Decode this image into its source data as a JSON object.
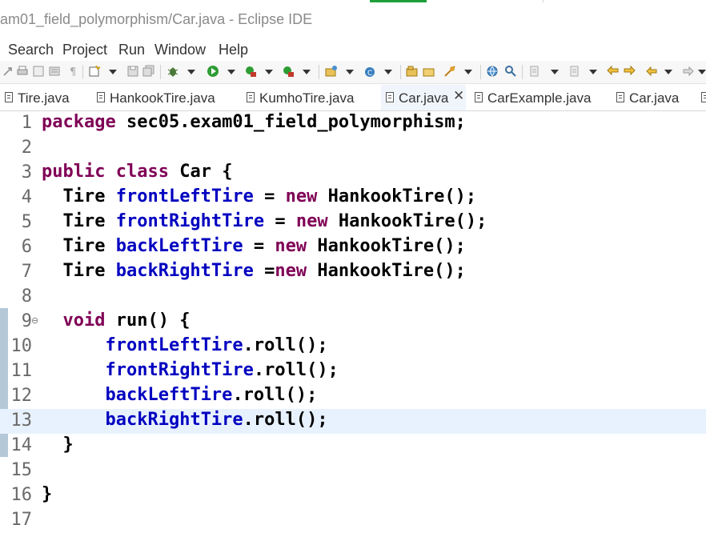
{
  "window": {
    "title": "am01_field_polymorphism/Car.java - Eclipse IDE"
  },
  "menu": [
    "Search",
    "Project",
    "Run",
    "Window",
    "Help"
  ],
  "toolbar": {
    "icons": [
      "arrow-icon",
      "print-icon",
      "format-icon",
      "pilcrow-icon",
      "new-icon",
      "save-icon",
      "save-all-icon",
      "debug-icon",
      "run-icon",
      "coverage-icon",
      "external-tools-icon",
      "new-java-project-icon",
      "new-class-icon",
      "open-type-icon",
      "search-icon",
      "globe-icon",
      "open-task-icon",
      "annotation-icon",
      "next-annotation-icon",
      "back-icon",
      "forward-icon"
    ]
  },
  "tabs": [
    {
      "label": "Tire.java",
      "active": false
    },
    {
      "label": "HankookTire.java",
      "active": false
    },
    {
      "label": "KumhoTire.java",
      "active": false
    },
    {
      "label": "Car.java",
      "active": true,
      "close": "✕"
    },
    {
      "label": "CarExample.java",
      "active": false
    },
    {
      "label": "Car.java",
      "active": false
    }
  ],
  "editor": {
    "current_line": 13,
    "lines": [
      {
        "n": "1",
        "tokens": [
          {
            "t": "package",
            "c": "kw"
          },
          {
            "t": " sec05.exam01_field_polymorphism;",
            "c": ""
          }
        ]
      },
      {
        "n": "2",
        "tokens": []
      },
      {
        "n": "3",
        "tokens": [
          {
            "t": "public",
            "c": "kw"
          },
          {
            "t": " ",
            "c": ""
          },
          {
            "t": "class",
            "c": "kw"
          },
          {
            "t": " Car {",
            "c": ""
          }
        ]
      },
      {
        "n": "4",
        "tokens": [
          {
            "t": "  Tire ",
            "c": ""
          },
          {
            "t": "frontLeftTire",
            "c": "fld"
          },
          {
            "t": " = ",
            "c": ""
          },
          {
            "t": "new",
            "c": "kw"
          },
          {
            "t": " HankookTire();",
            "c": ""
          }
        ]
      },
      {
        "n": "5",
        "tokens": [
          {
            "t": "  Tire ",
            "c": ""
          },
          {
            "t": "frontRightTire",
            "c": "fld"
          },
          {
            "t": " = ",
            "c": ""
          },
          {
            "t": "new",
            "c": "kw"
          },
          {
            "t": " HankookTire();",
            "c": ""
          }
        ]
      },
      {
        "n": "6",
        "tokens": [
          {
            "t": "  Tire ",
            "c": ""
          },
          {
            "t": "backLeftTire",
            "c": "fld"
          },
          {
            "t": " = ",
            "c": ""
          },
          {
            "t": "new",
            "c": "kw"
          },
          {
            "t": " HankookTire();",
            "c": ""
          }
        ]
      },
      {
        "n": "7",
        "tokens": [
          {
            "t": "  Tire ",
            "c": ""
          },
          {
            "t": "backRightTire",
            "c": "fld"
          },
          {
            "t": " =",
            "c": ""
          },
          {
            "t": "new",
            "c": "kw"
          },
          {
            "t": " HankookTire();",
            "c": ""
          }
        ]
      },
      {
        "n": "8",
        "tokens": []
      },
      {
        "n": "9",
        "fold": "⊖",
        "tokens": [
          {
            "t": "  ",
            "c": ""
          },
          {
            "t": "void",
            "c": "kw"
          },
          {
            "t": " run() {",
            "c": ""
          }
        ]
      },
      {
        "n": "10",
        "tokens": [
          {
            "t": "      ",
            "c": ""
          },
          {
            "t": "frontLeftTire",
            "c": "fld"
          },
          {
            "t": ".roll();",
            "c": ""
          }
        ]
      },
      {
        "n": "11",
        "tokens": [
          {
            "t": "      ",
            "c": ""
          },
          {
            "t": "frontRightTire",
            "c": "fld"
          },
          {
            "t": ".roll();",
            "c": ""
          }
        ]
      },
      {
        "n": "12",
        "tokens": [
          {
            "t": "      ",
            "c": ""
          },
          {
            "t": "backLeftTire",
            "c": "fld"
          },
          {
            "t": ".roll();",
            "c": ""
          }
        ]
      },
      {
        "n": "13",
        "tokens": [
          {
            "t": "      ",
            "c": ""
          },
          {
            "t": "backRightTire",
            "c": "fld"
          },
          {
            "t": ".roll();",
            "c": ""
          }
        ]
      },
      {
        "n": "14",
        "tokens": [
          {
            "t": "  }",
            "c": ""
          }
        ]
      },
      {
        "n": "15",
        "tokens": []
      },
      {
        "n": "16",
        "tokens": [
          {
            "t": "}",
            "c": ""
          }
        ]
      },
      {
        "n": "17",
        "tokens": []
      }
    ]
  },
  "colors": {
    "keyword": "#7f0055",
    "field": "#0000c0",
    "current_line": "#e8f2fe",
    "accent": "#1f9f3a"
  }
}
